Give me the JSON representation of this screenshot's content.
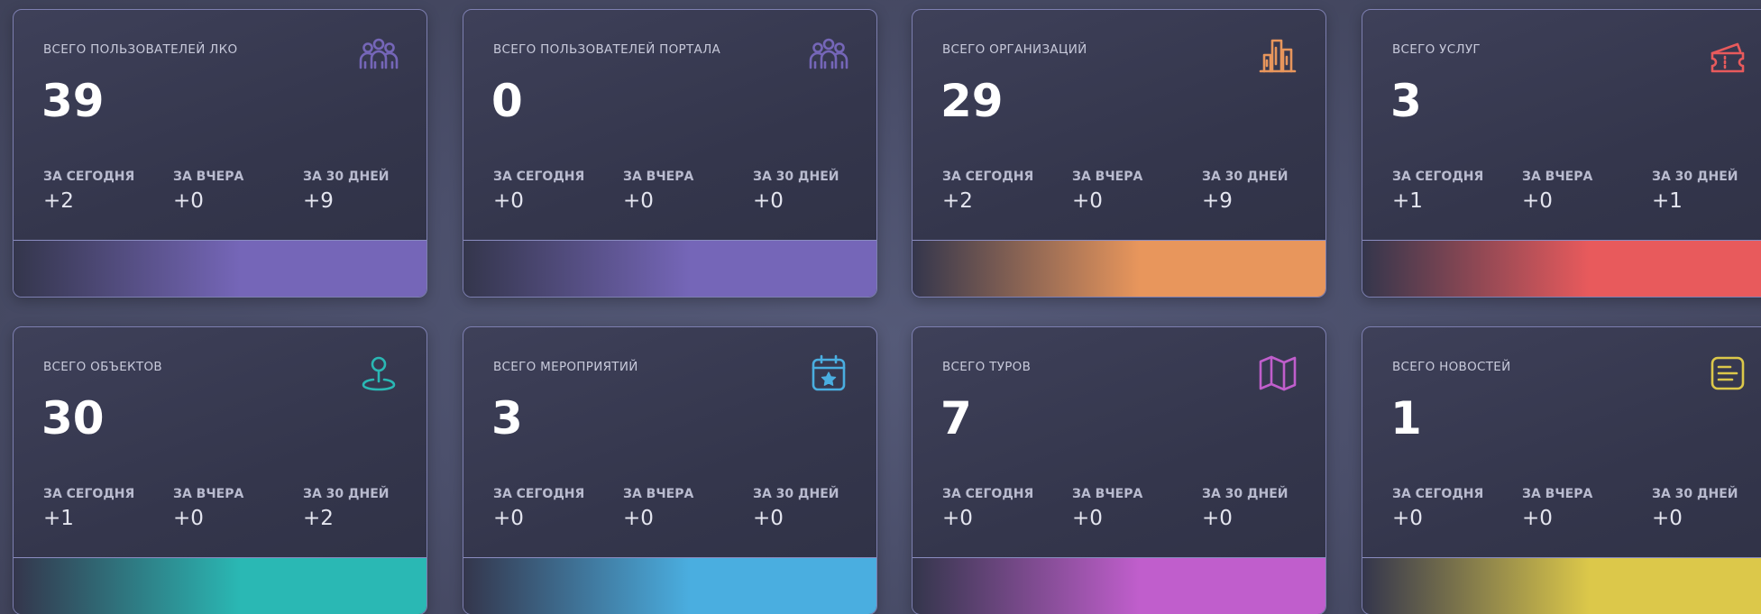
{
  "stat_labels": {
    "today": "ЗА СЕГОДНЯ",
    "yesterday": "ЗА ВЧЕРА",
    "month": "ЗА 30 ДНЕЙ"
  },
  "cards": [
    {
      "id": "lko-users",
      "title": "ВСЕГО ПОЛЬЗОВАТЕЛЕЙ ЛКО",
      "total": "39",
      "today": "+2",
      "yesterday": "+0",
      "month": "+9",
      "icon": "users-group-icon",
      "color": "#7566b8"
    },
    {
      "id": "portal-users",
      "title": "ВСЕГО ПОЛЬЗОВАТЕЛЕЙ ПОРТАЛА",
      "total": "0",
      "today": "+0",
      "yesterday": "+0",
      "month": "+0",
      "icon": "users-group-icon",
      "color": "#7566b8"
    },
    {
      "id": "organizations",
      "title": "ВСЕГО ОРГАНИЗАЦИЙ",
      "total": "29",
      "today": "+2",
      "yesterday": "+0",
      "month": "+9",
      "icon": "buildings-icon",
      "color": "#e8965c"
    },
    {
      "id": "services",
      "title": "ВСЕГО УСЛУГ",
      "total": "3",
      "today": "+1",
      "yesterday": "+0",
      "month": "+1",
      "icon": "ticket-icon",
      "color": "#e85a5c"
    },
    {
      "id": "objects",
      "title": "ВСЕГО ОБЪЕКТОВ",
      "total": "30",
      "today": "+1",
      "yesterday": "+0",
      "month": "+2",
      "icon": "location-pin-icon",
      "color": "#2ab8b4"
    },
    {
      "id": "events",
      "title": "ВСЕГО МЕРОПРИЯТИЙ",
      "total": "3",
      "today": "+0",
      "yesterday": "+0",
      "month": "+0",
      "icon": "calendar-star-icon",
      "color": "#4aaee0"
    },
    {
      "id": "tours",
      "title": "ВСЕГО ТУРОВ",
      "total": "7",
      "today": "+0",
      "yesterday": "+0",
      "month": "+0",
      "icon": "map-icon",
      "color": "#c05ecc"
    },
    {
      "id": "news",
      "title": "ВСЕГО НОВОСТЕЙ",
      "total": "1",
      "today": "+0",
      "yesterday": "+0",
      "month": "+0",
      "icon": "news-document-icon",
      "color": "#dcc84a"
    }
  ]
}
